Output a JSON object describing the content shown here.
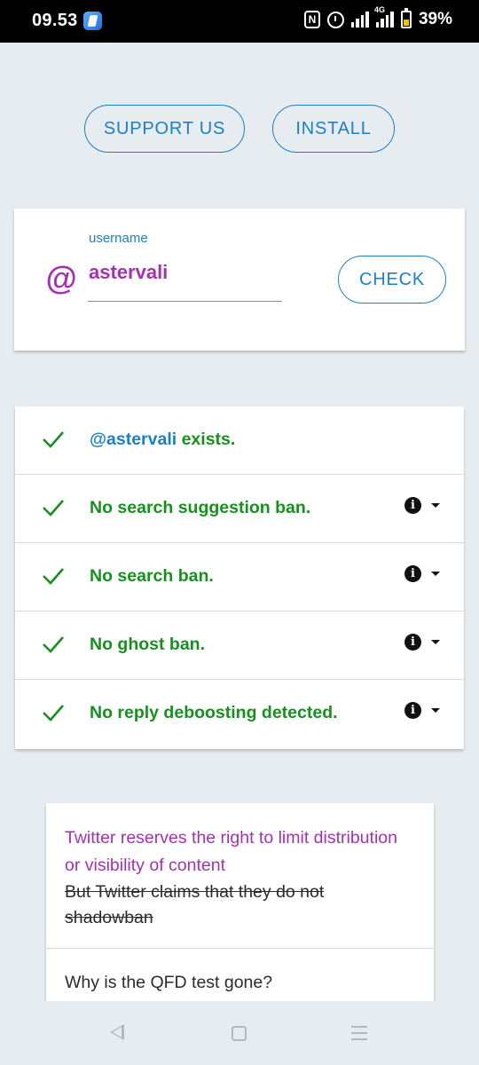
{
  "status_bar": {
    "time": "09.53",
    "network_label": "4G",
    "battery": "39%",
    "icons": [
      "app-icon",
      "nfc-icon",
      "alarm-icon",
      "signal-icon",
      "signal-4g-icon",
      "battery-icon"
    ]
  },
  "top_buttons": {
    "support_label": "SUPPORT US",
    "install_label": "INSTALL"
  },
  "username_form": {
    "icon": "@",
    "label": "username",
    "value": "astervali",
    "check_label": "CHECK"
  },
  "results": [
    {
      "status": "pass",
      "user": "@astervali",
      "text": " exists.",
      "has_info": false
    },
    {
      "status": "pass",
      "text": "No search suggestion ban.",
      "has_info": true
    },
    {
      "status": "pass",
      "text": "No search ban.",
      "has_info": true
    },
    {
      "status": "pass",
      "text": "No ghost ban.",
      "has_info": true
    },
    {
      "status": "pass",
      "text": "No reply deboosting detected.",
      "has_info": true
    }
  ],
  "info_card": {
    "highlight": "Twitter reserves the right to limit distribution or visibility of content",
    "strikethrough": "But Twitter claims that they do not shadowban",
    "question": "Why is the QFD test gone?"
  },
  "colors": {
    "accent_blue": "#1d80c3",
    "pass_green": "#17901f",
    "purple": "#a432b0",
    "background": "#e6ecf0"
  },
  "nav_bar": {
    "icons": [
      "back-icon",
      "home-icon",
      "recents-icon"
    ]
  }
}
